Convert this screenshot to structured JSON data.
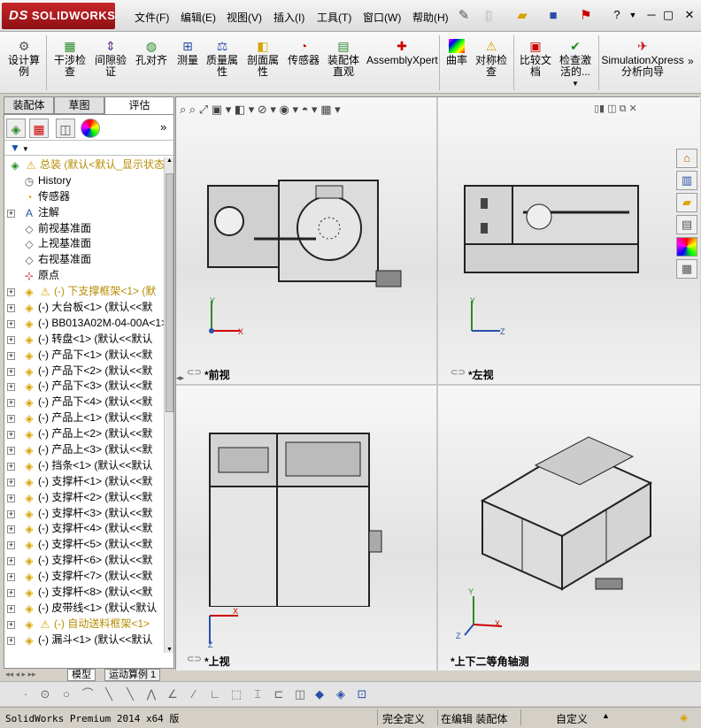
{
  "app": {
    "logo": "SOLIDWORKS",
    "logo_mark": "DS"
  },
  "menu": [
    "文件(F)",
    "编辑(E)",
    "视图(V)",
    "插入(I)",
    "工具(T)",
    "窗口(W)",
    "帮助(H)"
  ],
  "commands": [
    {
      "label": "设计算\n例",
      "icon": "design-table-icon"
    },
    {
      "label": "干涉检\n查",
      "icon": "interference-check-icon"
    },
    {
      "label": "间隙验\n证",
      "icon": "clearance-check-icon"
    },
    {
      "label": "孔对齐",
      "icon": "hole-alignment-icon"
    },
    {
      "label": "测量",
      "icon": "measure-icon"
    },
    {
      "label": "质量属\n性",
      "icon": "mass-properties-icon"
    },
    {
      "label": "剖面属\n性",
      "icon": "section-properties-icon"
    },
    {
      "label": "传感器",
      "icon": "sensor-icon"
    },
    {
      "label": "装配体\n直观",
      "icon": "assembly-visualization-icon"
    },
    {
      "label": "AssemblyXpert",
      "icon": "assemblyxpert-icon"
    },
    {
      "label": "曲率",
      "icon": "curvature-icon"
    },
    {
      "label": "对称检\n查",
      "icon": "symmetry-check-icon"
    },
    {
      "label": "比较文\n档",
      "icon": "compare-documents-icon"
    },
    {
      "label": "检查激\n活的...",
      "icon": "check-active-icon"
    },
    {
      "label": "SimulationXpress\n分析向导",
      "icon": "simulationxpress-icon"
    }
  ],
  "left_tabs": [
    "装配体",
    "草图",
    "评估"
  ],
  "tree": [
    {
      "text": "总装  (默认<默认_显示状态",
      "icon": "assembly",
      "warn": true,
      "yellow": true,
      "pm": "",
      "indent": 0
    },
    {
      "text": "History",
      "icon": "history",
      "pm": "",
      "indent": 1
    },
    {
      "text": "传感器",
      "icon": "sensor",
      "pm": "",
      "indent": 1
    },
    {
      "text": "注解",
      "icon": "annotation",
      "pm": "+",
      "indent": 1
    },
    {
      "text": "前视基准面",
      "icon": "plane",
      "pm": "",
      "indent": 1
    },
    {
      "text": "上视基准面",
      "icon": "plane",
      "pm": "",
      "indent": 1
    },
    {
      "text": "右视基准面",
      "icon": "plane",
      "pm": "",
      "indent": 1
    },
    {
      "text": "原点",
      "icon": "origin",
      "pm": "",
      "indent": 1
    },
    {
      "text": "(-) 下支撑框架<1> (默",
      "icon": "subasm",
      "warn": true,
      "yellow": true,
      "pm": "+",
      "indent": 1
    },
    {
      "text": "(-) 大台板<1> (默认<<默",
      "icon": "part",
      "pm": "+",
      "indent": 1
    },
    {
      "text": "(-) BB013A02M-04-00A<1>",
      "icon": "part",
      "pm": "+",
      "indent": 1
    },
    {
      "text": "(-) 转盘<1> (默认<<默认",
      "icon": "part",
      "pm": "+",
      "indent": 1
    },
    {
      "text": "(-) 产品下<1> (默认<<默",
      "icon": "part",
      "pm": "+",
      "indent": 1
    },
    {
      "text": "(-) 产品下<2> (默认<<默",
      "icon": "part",
      "pm": "+",
      "indent": 1
    },
    {
      "text": "(-) 产品下<3> (默认<<默",
      "icon": "part",
      "pm": "+",
      "indent": 1
    },
    {
      "text": "(-) 产品下<4> (默认<<默",
      "icon": "part",
      "pm": "+",
      "indent": 1
    },
    {
      "text": "(-) 产品上<1> (默认<<默",
      "icon": "part",
      "pm": "+",
      "indent": 1
    },
    {
      "text": "(-) 产品上<2> (默认<<默",
      "icon": "part",
      "pm": "+",
      "indent": 1
    },
    {
      "text": "(-) 产品上<3> (默认<<默",
      "icon": "part",
      "pm": "+",
      "indent": 1
    },
    {
      "text": "(-) 挡条<1> (默认<<默认",
      "icon": "part",
      "pm": "+",
      "indent": 1
    },
    {
      "text": "(-) 支撑杆<1> (默认<<默",
      "icon": "part",
      "pm": "+",
      "indent": 1
    },
    {
      "text": "(-) 支撑杆<2> (默认<<默",
      "icon": "part",
      "pm": "+",
      "indent": 1
    },
    {
      "text": "(-) 支撑杆<3> (默认<<默",
      "icon": "part",
      "pm": "+",
      "indent": 1
    },
    {
      "text": "(-) 支撑杆<4> (默认<<默",
      "icon": "part",
      "pm": "+",
      "indent": 1
    },
    {
      "text": "(-) 支撑杆<5> (默认<<默",
      "icon": "part",
      "pm": "+",
      "indent": 1
    },
    {
      "text": "(-) 支撑杆<6> (默认<<默",
      "icon": "part",
      "pm": "+",
      "indent": 1
    },
    {
      "text": "(-) 支撑杆<7> (默认<<默",
      "icon": "part",
      "pm": "+",
      "indent": 1
    },
    {
      "text": "(-) 支撑杆<8> (默认<<默",
      "icon": "part",
      "pm": "+",
      "indent": 1
    },
    {
      "text": "(-) 皮带线<1> (默认<默认",
      "icon": "part",
      "pm": "+",
      "indent": 1
    },
    {
      "text": "(-) 自动送料框架<1>",
      "icon": "subasm",
      "warn": true,
      "yellow": true,
      "pm": "+",
      "indent": 1
    },
    {
      "text": "(-) 漏斗<1> (默认<<默认",
      "icon": "part",
      "pm": "+",
      "indent": 1
    }
  ],
  "bottom_tabs": [
    "模型",
    "运动算例 1"
  ],
  "views": [
    {
      "label": "*前视",
      "axes": [
        "Y",
        "X"
      ]
    },
    {
      "label": "*左视",
      "axes": [
        "Y",
        "Z"
      ]
    },
    {
      "label": "*上视",
      "axes": [
        "X",
        "Z"
      ]
    },
    {
      "label": "*上下二等角轴测",
      "axes": [
        "Y",
        "X",
        "Z"
      ]
    }
  ],
  "status": {
    "product": "SolidWorks Premium 2014 x64 版",
    "definition": "完全定义",
    "mode": "在编辑 装配体",
    "units": "自定义"
  }
}
